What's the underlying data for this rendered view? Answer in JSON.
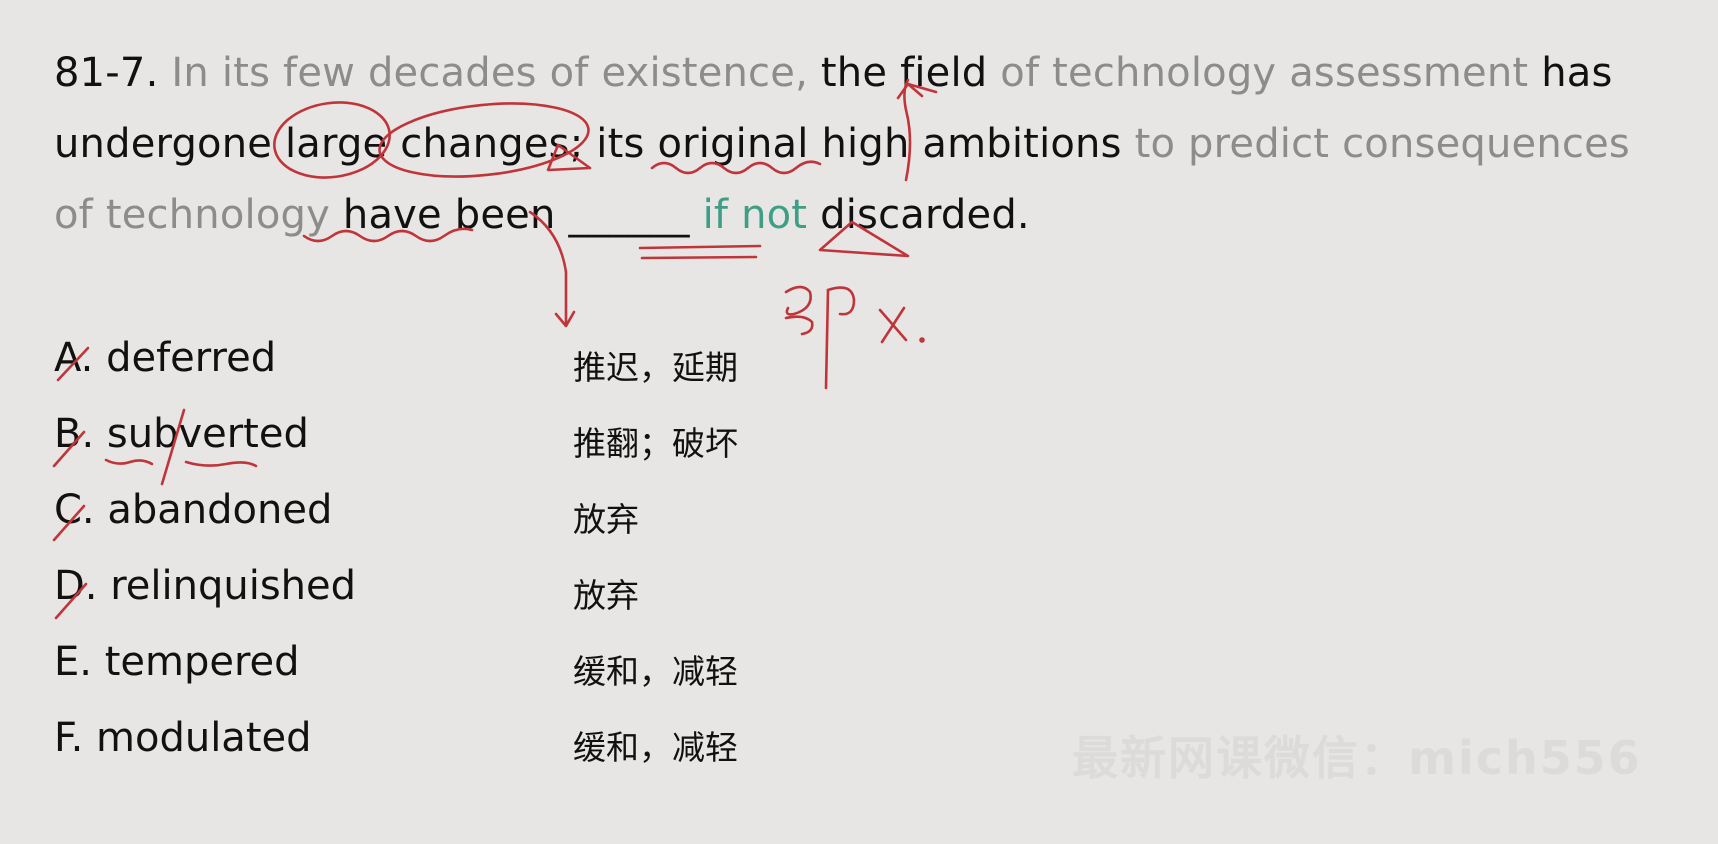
{
  "question": {
    "number": "81-7.",
    "seg1": "In its few decades of existence,",
    "seg2": "the field",
    "seg3": "of technology assessment",
    "seg4": "has undergone large changes; its original high ambitions",
    "seg5": "to predict consequences of technology",
    "seg6": "have been",
    "blank": "______",
    "seg7": "if not",
    "seg8": "discarded."
  },
  "options": [
    {
      "letter": "A.",
      "word": "deferred",
      "meaning": "推迟，延期"
    },
    {
      "letter": "B.",
      "word": "subverted",
      "meaning": "推翻；破坏"
    },
    {
      "letter": "C.",
      "word": "abandoned",
      "meaning": "放弃"
    },
    {
      "letter": "D.",
      "word": "relinquished",
      "meaning": "放弃"
    },
    {
      "letter": "E.",
      "word": "tempered",
      "meaning": "缓和，减轻"
    },
    {
      "letter": "F.",
      "word": "modulated",
      "meaning": "缓和，减轻"
    }
  ],
  "annotations": {
    "handwritten": "即 X."
  },
  "watermark": "最新网课微信：mich556",
  "colors": {
    "background": "#e7e6e4",
    "ink": "#c0353a",
    "faded_text": "#8c8c8c",
    "highlight": "#3f9e86"
  }
}
